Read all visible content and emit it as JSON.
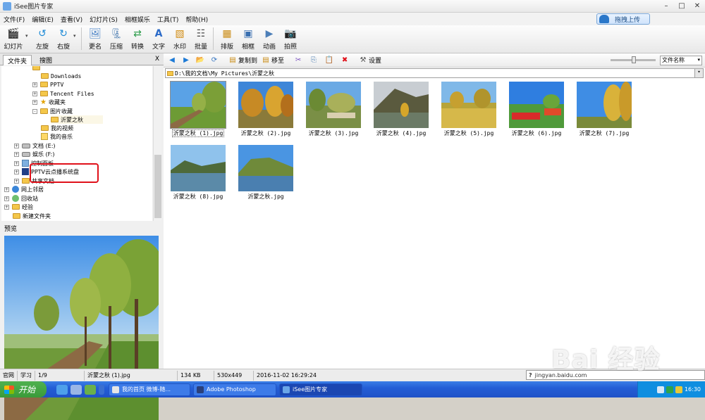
{
  "window": {
    "title": "iSee图片专家"
  },
  "menu": {
    "items": [
      "文件(F)",
      "编辑(E)",
      "查看(V)",
      "幻灯片(S)",
      "相框娱乐",
      "工具(T)",
      "帮助(H)"
    ],
    "upload_button": "拖拽上传"
  },
  "toolbar": {
    "buttons": [
      "幻灯片",
      "左旋",
      "右旋",
      "更名",
      "压缩",
      "转换",
      "文字",
      "水印",
      "批量",
      "排版",
      "相框",
      "动画",
      "拍照"
    ]
  },
  "left_panel": {
    "tabs": [
      "文件夹",
      "搜图"
    ],
    "close": "X",
    "tree": [
      {
        "label": "Downloads",
        "expander": "",
        "icon": "folder"
      },
      {
        "label": "PPTV",
        "expander": "+",
        "icon": "folder"
      },
      {
        "label": "Tencent Files",
        "expander": "+",
        "icon": "folder"
      },
      {
        "label": "收藏夹",
        "expander": "+",
        "icon": "star"
      },
      {
        "label": "图片收藏",
        "expander": "-",
        "icon": "folder"
      },
      {
        "label": "沂蒙之秋",
        "expander": "",
        "icon": "folder"
      },
      {
        "label": "我的视频",
        "expander": "",
        "icon": "folder"
      },
      {
        "label": "我的音乐",
        "expander": "",
        "icon": "note"
      },
      {
        "label": "文档 (E:)",
        "expander": "+",
        "icon": "drive"
      },
      {
        "label": "娱乐 (F:)",
        "expander": "+",
        "icon": "drive"
      },
      {
        "label": "控制面板",
        "expander": "+",
        "icon": "control"
      },
      {
        "label": "PPTV云点播系统盘",
        "expander": "+",
        "icon": "pptv"
      },
      {
        "label": "共享文档",
        "expander": "+",
        "icon": "folder"
      },
      {
        "label": "网上邻居",
        "expander": "+",
        "icon": "globe"
      },
      {
        "label": "回收站",
        "expander": "+",
        "icon": "recycle"
      },
      {
        "label": "经验",
        "expander": "+",
        "icon": "folder"
      },
      {
        "label": "新建文件夹",
        "expander": "",
        "icon": "folder"
      }
    ],
    "preview_title": "预览"
  },
  "right_panel": {
    "buttons": [
      "复制到",
      "移至",
      "设置"
    ],
    "sort_select": "文件名称",
    "path": "D:\\我的文档\\My Pictures\\沂蒙之秋",
    "thumbnails": [
      "沂蒙之秋 (1).jpg",
      "沂蒙之秋 (2).jpg",
      "沂蒙之秋 (3).jpg",
      "沂蒙之秋 (4).jpg",
      "沂蒙之秋 (5).jpg",
      "沂蒙之秋 (6).jpg",
      "沂蒙之秋 (7).jpg",
      "沂蒙之秋 (8).jpg",
      "沂蒙之秋.jpg"
    ]
  },
  "status": {
    "home": "官网",
    "learn": "学习",
    "count": "1/9",
    "file": "沂蒙之秋 (1).jpg",
    "size": "134 KB",
    "dimensions": "530x449",
    "date": "2016-11-02 16:29:24",
    "sticky": "jingyan.baidu.com"
  },
  "taskbar": {
    "start": "开始",
    "tasks": [
      "我的首页 微博-随...",
      "Adobe Photoshop",
      "iSee图片专家"
    ],
    "time": "16:30"
  },
  "watermark": {
    "text": "Bai 经验"
  }
}
